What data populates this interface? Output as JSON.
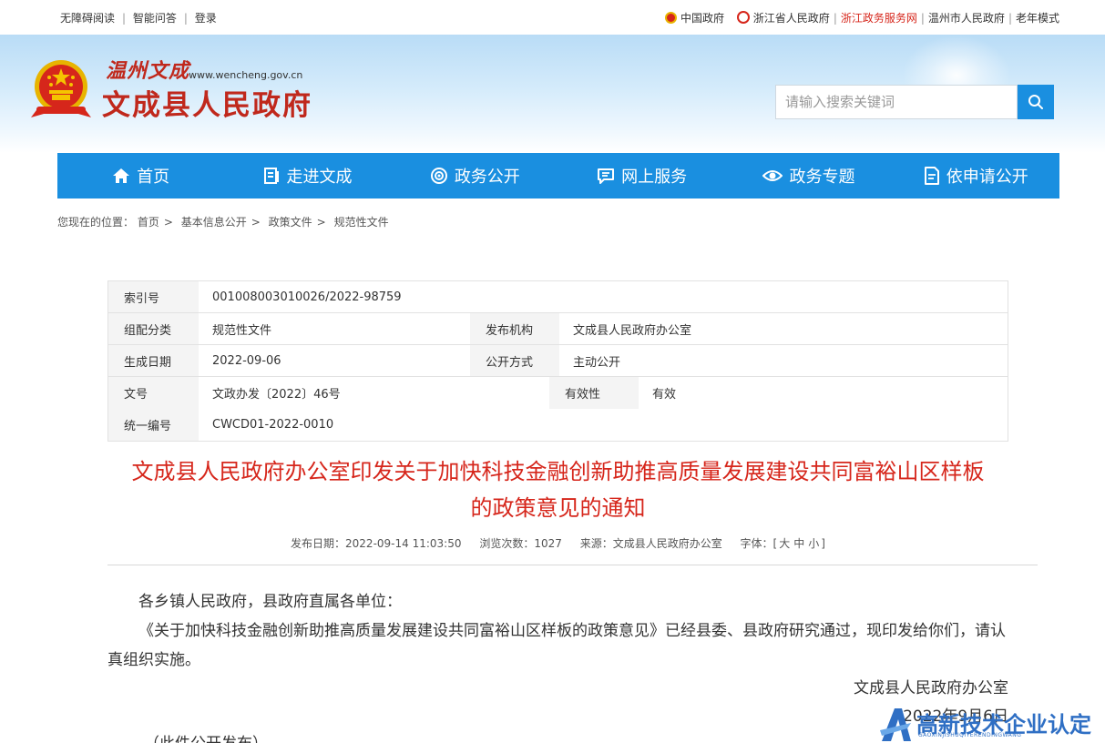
{
  "topbar": {
    "left": [
      "无障碍阅读",
      "智能问答",
      "登录"
    ],
    "right": [
      {
        "label": "中国政府",
        "highlight": false
      },
      {
        "label": "浙江省人民政府",
        "highlight": false
      },
      {
        "label": "浙江政务服务网",
        "highlight": true
      },
      {
        "label": "温州市人民政府",
        "highlight": false
      },
      {
        "label": "老年模式",
        "highlight": false
      }
    ]
  },
  "header": {
    "script_logo": "温州文成",
    "url": "www.wencheng.gov.cn",
    "site_title": "文成县人民政府",
    "search_placeholder": "请输入搜索关键词"
  },
  "nav": {
    "items": [
      {
        "label": "首页",
        "icon": "home-icon"
      },
      {
        "label": "走进文成",
        "icon": "book-icon"
      },
      {
        "label": "政务公开",
        "icon": "broadcast-icon"
      },
      {
        "label": "网上服务",
        "icon": "chat-icon"
      },
      {
        "label": "政务专题",
        "icon": "eye-icon"
      },
      {
        "label": "依申请公开",
        "icon": "document-icon"
      }
    ]
  },
  "breadcrumb": {
    "prefix": "您现在的位置：",
    "items": [
      "首页",
      "基本信息公开",
      "政策文件",
      "规范性文件"
    ]
  },
  "info": {
    "index_label": "索引号",
    "index_value": "001008003010026/2022-98759",
    "category_label": "组配分类",
    "category_value": "规范性文件",
    "issuer_label": "发布机构",
    "issuer_value": "文成县人民政府办公室",
    "date_label": "生成日期",
    "date_value": "2022-09-06",
    "method_label": "公开方式",
    "method_value": "主动公开",
    "docno_label": "文号",
    "docno_value": "文政办发〔2022〕46号",
    "validity_label": "有效性",
    "validity_value": "有效",
    "uniform_label": "统一编号",
    "uniform_value": "CWCD01-2022-0010"
  },
  "document": {
    "title_line1": "文成县人民政府办公室印发关于加快科技金融创新助推高质量发展建设共同富裕山区样板",
    "title_line2": "的政策意见的通知",
    "meta_date": "发布日期：2022-09-14 11:03:50",
    "meta_views": "浏览次数：1027",
    "meta_source": "来源：文成县人民政府办公室",
    "meta_font_prefix": "字体：[",
    "font_large": "大",
    "font_medium": "中",
    "font_small": "小",
    "meta_font_suffix": "]",
    "salutation": "各乡镇人民政府，县政府直属各单位：",
    "body": "《关于加快科技金融创新助推高质量发展建设共同富裕山区样板的政策意见》已经县委、县政府研究通过，现印发给你们，请认真组织实施。",
    "signature": "文成县人民政府办公室",
    "sign_date": "2022年9月6日",
    "note": "（此件公开发布）"
  },
  "watermark": {
    "text": "高新技术企业认定网",
    "sub": "GAOXINJISHUQIYERENDINGWANG"
  },
  "colors": {
    "accent_blue": "#1a8fe0",
    "title_red": "#d6261b",
    "logo_red": "#c0281c"
  }
}
